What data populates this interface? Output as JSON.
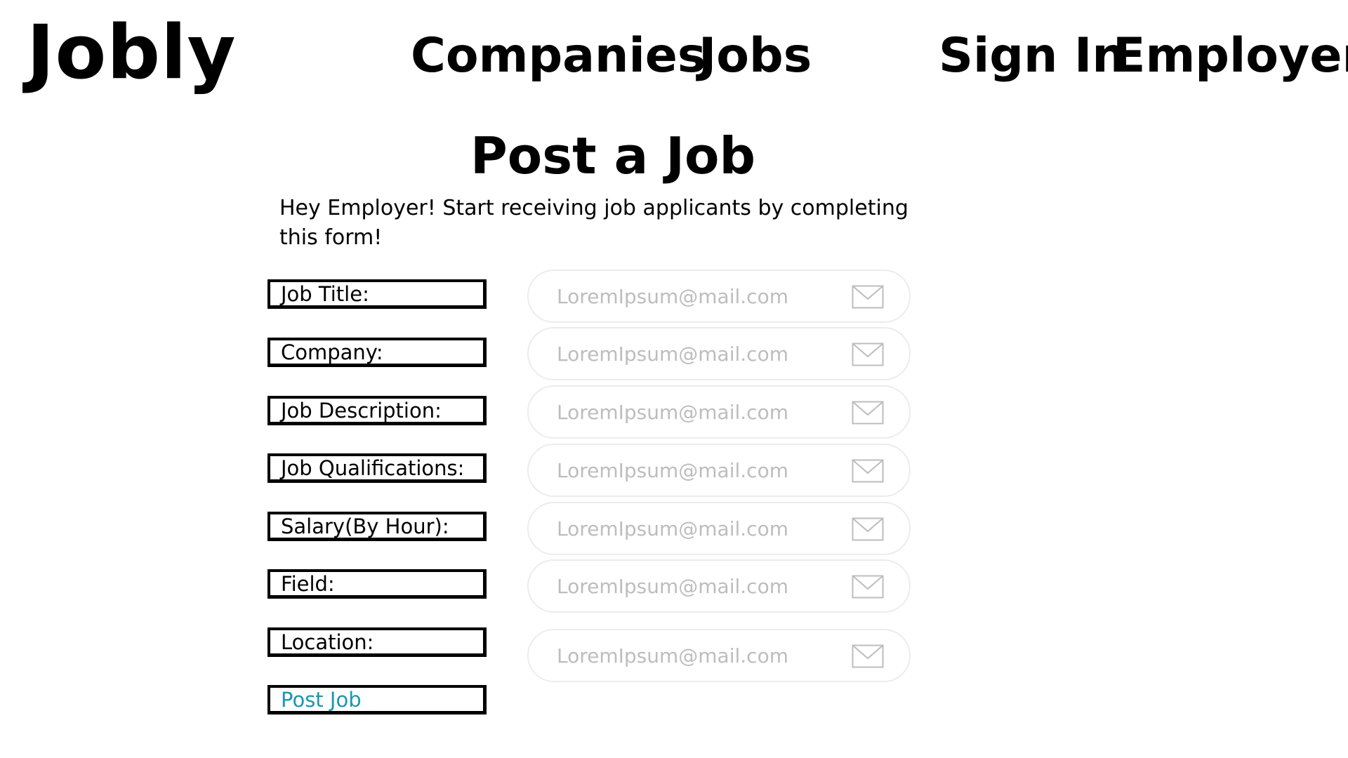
{
  "header": {
    "logo": "Jobly",
    "nav": {
      "companies": "Companies",
      "jobs": "Jobs",
      "sign_in": "Sign In",
      "employer": "Employer"
    }
  },
  "main": {
    "title": "Post a Job",
    "intro": "Hey Employer! Start receiving job applicants by completing this form!",
    "labels": {
      "job_title": "Job Title:",
      "company": "Company:",
      "job_description": "Job Description:",
      "job_qualifications": "Job Qualifications:",
      "salary": "Salary(By Hour):",
      "field": "Field:",
      "location": "Location:"
    },
    "post_button": "Post Job",
    "inputs": {
      "placeholder": "LoremIpsum@mail.com",
      "icon": "mail-icon"
    }
  },
  "colors": {
    "accent_link": "#1a97b0",
    "input_border": "#ececec",
    "placeholder": "#bdbdbd"
  }
}
